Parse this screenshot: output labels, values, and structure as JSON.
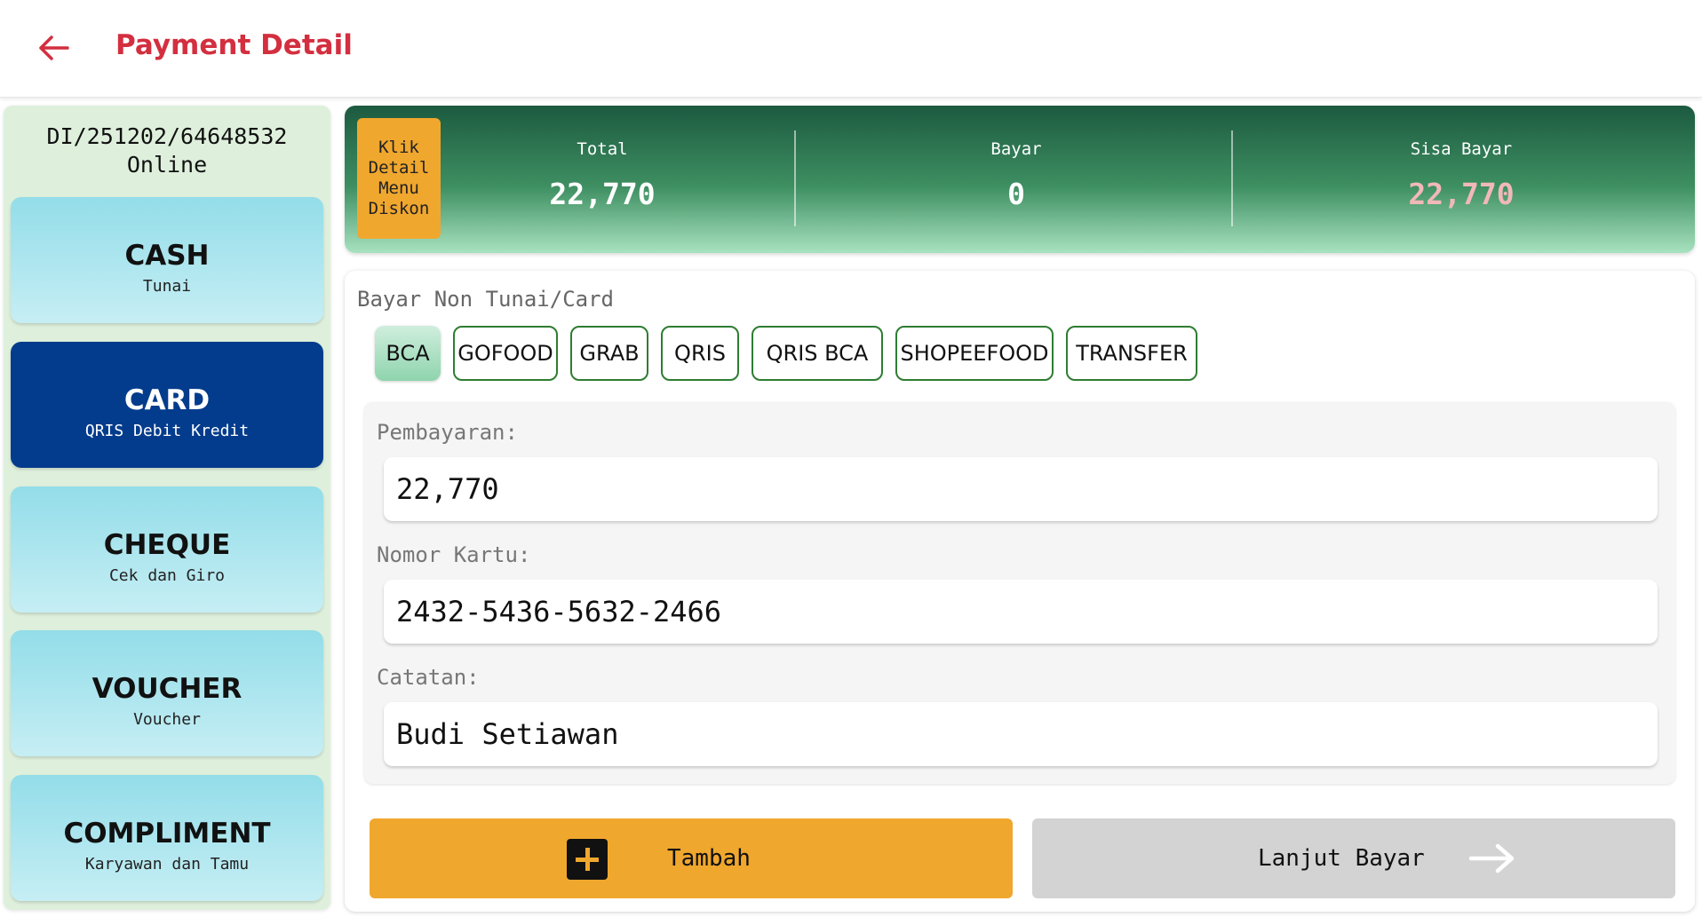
{
  "header": {
    "title": "Payment Detail",
    "back_icon": "arrow-left-icon"
  },
  "sidebar": {
    "order_id": "DI/251202/64648532",
    "order_status": "Online",
    "methods": [
      {
        "title": "CASH",
        "subtitle": "Tunai",
        "active": false
      },
      {
        "title": "CARD",
        "subtitle": "QRIS Debit Kredit",
        "active": true
      },
      {
        "title": "CHEQUE",
        "subtitle": "Cek dan Giro",
        "active": false
      },
      {
        "title": "VOUCHER",
        "subtitle": "Voucher",
        "active": false
      },
      {
        "title": "COMPLIMENT",
        "subtitle": "Karyawan dan Tamu",
        "active": false
      }
    ]
  },
  "summary": {
    "diskon_label": "Klik Detail Menu Diskon",
    "total_label": "Total",
    "total_value": "22,770",
    "bayar_label": "Bayar",
    "bayar_value": "0",
    "sisa_label": "Sisa Bayar",
    "sisa_value": "22,770",
    "sisa_color": "#f2b8b8"
  },
  "payment": {
    "section_title": "Bayar Non Tunai/Card",
    "banks": [
      "BCA",
      "GOFOOD",
      "GRAB",
      "QRIS",
      "QRIS BCA",
      "SHOPEEFOOD",
      "TRANSFER"
    ],
    "selected_bank": "BCA",
    "pembayaran_label": "Pembayaran:",
    "pembayaran_value": "22,770",
    "nomor_kartu_label": "Nomor Kartu:",
    "nomor_kartu_value": "2432-5436-5632-2466",
    "catatan_label": "Catatan:",
    "catatan_value": "Budi Setiawan"
  },
  "actions": {
    "tambah_label": "Tambah",
    "tambah_icon": "plus-square-icon",
    "lanjut_label": "Lanjut Bayar",
    "lanjut_icon": "arrow-right-icon"
  },
  "colors": {
    "brand_red": "#d32f3f",
    "accent_orange": "#f0a72e",
    "card_active": "#033c8c",
    "chip_border": "#2e7d32"
  }
}
